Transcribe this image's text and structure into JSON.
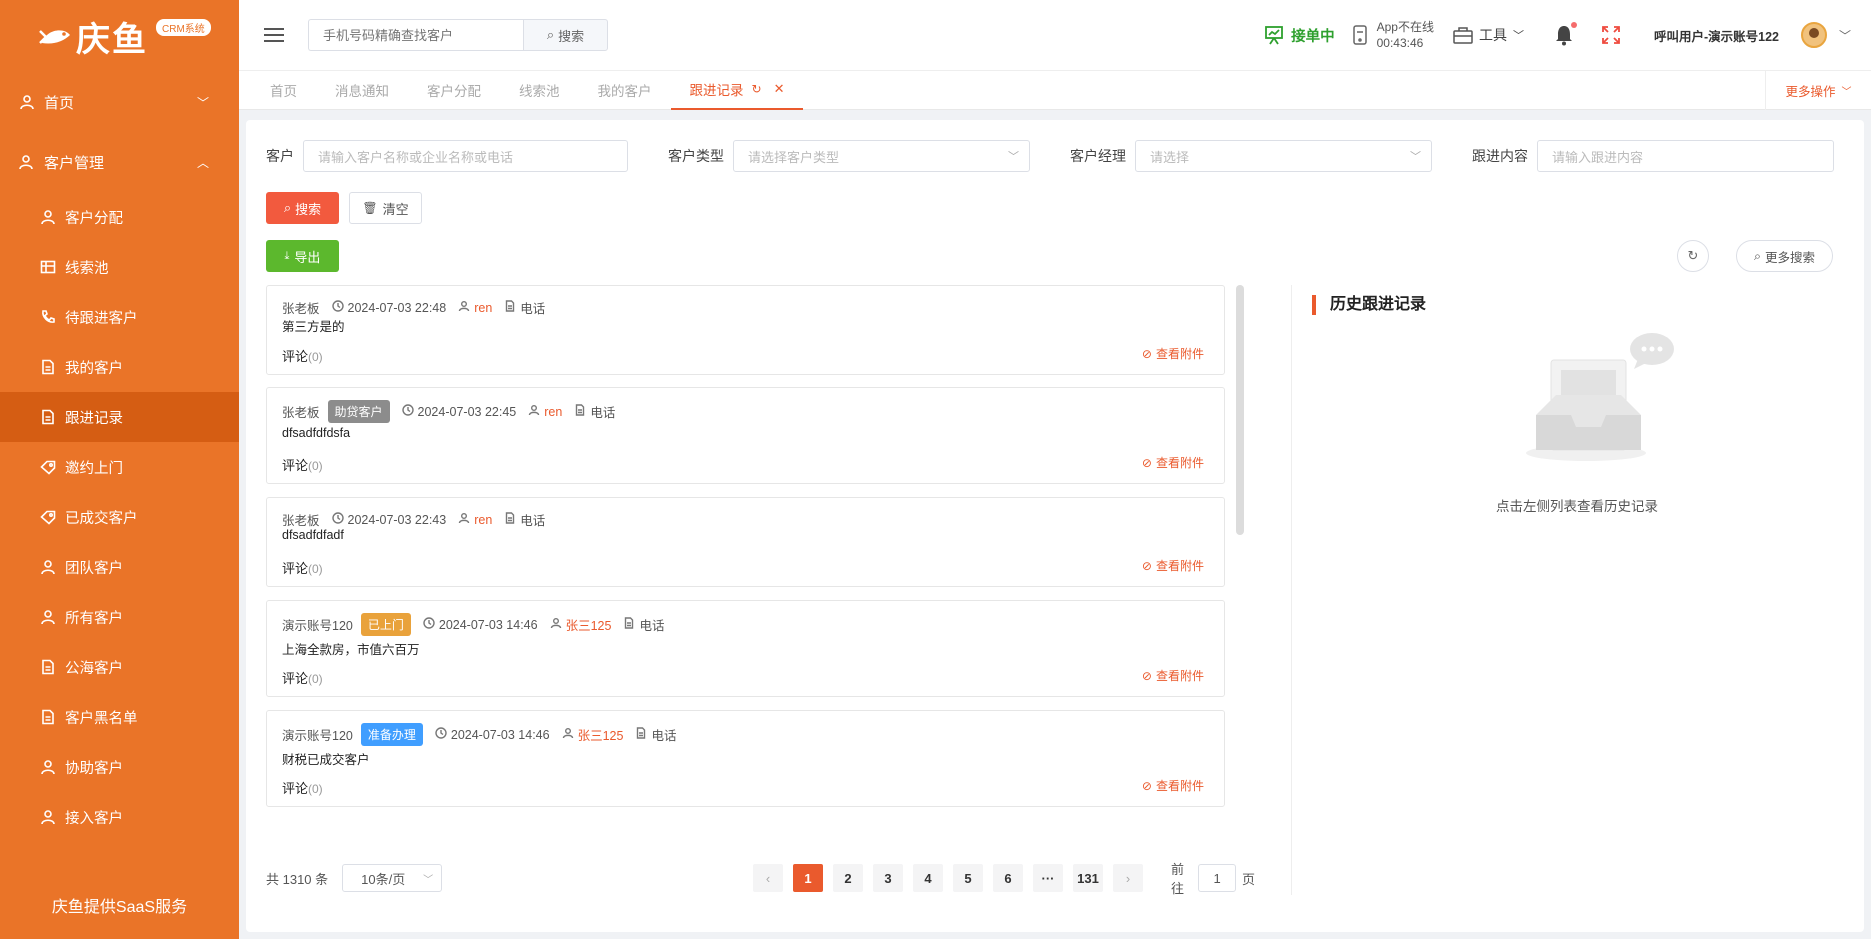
{
  "brand": {
    "logo_text": "庆鱼",
    "badge": "CRM系统",
    "footer": "庆鱼提供SaaS服务"
  },
  "sidebar": {
    "home": "首页",
    "customer_mgmt": "客户管理",
    "items": [
      {
        "label": "客户分配",
        "icon": "user-icon"
      },
      {
        "label": "线索池",
        "icon": "table-icon"
      },
      {
        "label": "待跟进客户",
        "icon": "phone-icon"
      },
      {
        "label": "我的客户",
        "icon": "document-icon"
      },
      {
        "label": "跟进记录",
        "icon": "document-icon",
        "active": true
      },
      {
        "label": "邀约上门",
        "icon": "tag-icon"
      },
      {
        "label": "已成交客户",
        "icon": "tag-icon"
      },
      {
        "label": "团队客户",
        "icon": "user-icon"
      },
      {
        "label": "所有客户",
        "icon": "user-icon"
      },
      {
        "label": "公海客户",
        "icon": "document-icon"
      },
      {
        "label": "客户黑名单",
        "icon": "document-icon"
      },
      {
        "label": "协助客户",
        "icon": "user-icon"
      },
      {
        "label": "接入客户",
        "icon": "user-icon"
      }
    ]
  },
  "topbar": {
    "search_placeholder": "手机号码精确查找客户",
    "search_button": "搜索",
    "accept_status": "接单中",
    "app_status": "App不在线",
    "app_timer": "00:43:46",
    "tools": "工具",
    "user": "呼叫用户-演示账号122"
  },
  "tabs": [
    {
      "label": "首页"
    },
    {
      "label": "消息通知"
    },
    {
      "label": "客户分配"
    },
    {
      "label": "线索池"
    },
    {
      "label": "我的客户"
    },
    {
      "label": "跟进记录",
      "active": true
    }
  ],
  "more_ops": "更多操作",
  "filters": {
    "customer_label": "客户",
    "customer_placeholder": "请输入客户名称或企业名称或电话",
    "type_label": "客户类型",
    "type_placeholder": "请选择客户类型",
    "manager_label": "客户经理",
    "manager_placeholder": "请选择",
    "content_label": "跟进内容",
    "content_placeholder": "请输入跟进内容"
  },
  "buttons": {
    "search": "搜索",
    "clear": "清空",
    "export": "导出",
    "more_search": "更多搜索"
  },
  "records": [
    {
      "customer": "张老板",
      "tag": "",
      "tag_color": "",
      "time": "2024-07-03 22:48",
      "manager": "ren",
      "method": "电话",
      "content": "第三方是的",
      "comment_label": "评论",
      "comment_count": "(0)",
      "attachment": "查看附件"
    },
    {
      "customer": "张老板",
      "tag": "助贷客户",
      "tag_color": "#8c8c8c",
      "time": "2024-07-03 22:45",
      "manager": "ren",
      "method": "电话",
      "content": "dfsadfdfdsfa",
      "comment_label": "评论",
      "comment_count": "(0)",
      "attachment": "查看附件"
    },
    {
      "customer": "张老板",
      "tag": "",
      "tag_color": "",
      "time": "2024-07-03 22:43",
      "manager": "ren",
      "method": "电话",
      "content": "dfsadfdfadf",
      "comment_label": "评论",
      "comment_count": "(0)",
      "attachment": "查看附件"
    },
    {
      "customer": "演示账号120",
      "tag": "已上门",
      "tag_color": "#e9a23b",
      "time": "2024-07-03 14:46",
      "manager": "张三125",
      "method": "电话",
      "content": "上海全款房，市值六百万",
      "comment_label": "评论",
      "comment_count": "(0)",
      "attachment": "查看附件"
    },
    {
      "customer": "演示账号120",
      "tag": "准备办理",
      "tag_color": "#409eff",
      "time": "2024-07-03 14:46",
      "manager": "张三125",
      "method": "电话",
      "content": "财税已成交客户",
      "comment_label": "评论",
      "comment_count": "(0)",
      "attachment": "查看附件"
    }
  ],
  "pagination": {
    "total": "共 1310 条",
    "page_size": "10条/页",
    "pages": [
      "1",
      "2",
      "3",
      "4",
      "5",
      "6",
      "···",
      "131"
    ],
    "current": "1",
    "goto_prefix": "前往",
    "goto_value": "1",
    "goto_suffix": "页"
  },
  "history": {
    "title": "历史跟进记录",
    "empty_text": "点击左侧列表查看历史记录"
  },
  "colors": {
    "brand": "#ea7428",
    "accent": "#ea5a2d",
    "export": "#5cb82d",
    "online": "#2ea02e"
  }
}
